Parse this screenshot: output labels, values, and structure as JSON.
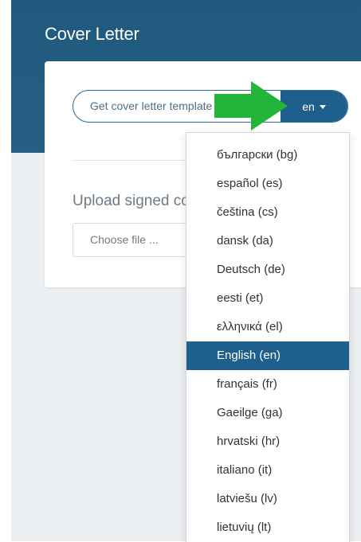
{
  "page": {
    "title": "Cover Letter"
  },
  "template_button": {
    "label": "Get cover letter template",
    "language": "en"
  },
  "upload": {
    "label": "Upload signed cover letter",
    "file_placeholder": "Choose file ..."
  },
  "languages": [
    {
      "label": "български (bg)",
      "selected": false
    },
    {
      "label": "español (es)",
      "selected": false
    },
    {
      "label": "čeština (cs)",
      "selected": false
    },
    {
      "label": "dansk (da)",
      "selected": false
    },
    {
      "label": "Deutsch (de)",
      "selected": false
    },
    {
      "label": "eesti (et)",
      "selected": false
    },
    {
      "label": "ελληνικά (el)",
      "selected": false
    },
    {
      "label": "English (en)",
      "selected": true
    },
    {
      "label": "français (fr)",
      "selected": false
    },
    {
      "label": "Gaeilge (ga)",
      "selected": false
    },
    {
      "label": "hrvatski (hr)",
      "selected": false
    },
    {
      "label": "italiano (it)",
      "selected": false
    },
    {
      "label": "latviešu (lv)",
      "selected": false
    },
    {
      "label": "lietuvių (lt)",
      "selected": false
    }
  ],
  "colors": {
    "header": "#1f5a7e",
    "accent": "#1e5f8e",
    "arrow": "#22b53a"
  }
}
